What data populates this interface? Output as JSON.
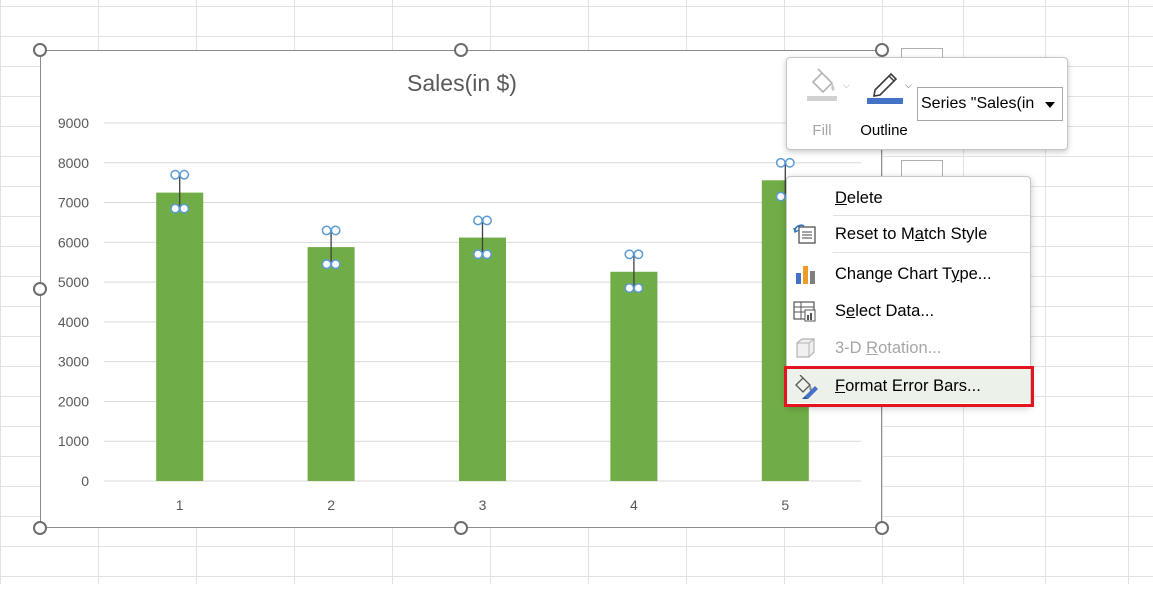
{
  "colors": {
    "bar_fill": "#70ad47",
    "gridline": "#d9d9d9",
    "error_handle": "#5b9bd5",
    "menu_highlight": "#ecf2ea",
    "annotation_border": "#e3131f",
    "outline_icon_bar": "#4472c4"
  },
  "chart_data": {
    "type": "bar",
    "title": "Sales(in $)",
    "categories": [
      "1",
      "2",
      "3",
      "4",
      "5"
    ],
    "series": [
      {
        "values": [
          7250,
          5880,
          6120,
          5260,
          7560
        ],
        "color": "#70ad47"
      }
    ],
    "error_bars": {
      "type": "standard deviation",
      "low": [
        6850,
        5450,
        5700,
        4850,
        7150
      ],
      "high": [
        7700,
        6300,
        6550,
        5700,
        8000
      ]
    },
    "ylim": [
      0,
      9000
    ],
    "yticks": [
      0,
      1000,
      2000,
      3000,
      4000,
      5000,
      6000,
      7000,
      8000,
      9000
    ],
    "xlabel": "",
    "ylabel": "",
    "grid": true,
    "legend": "none"
  },
  "mini_toolbar": {
    "fill_label": "Fill",
    "fill_icon": "paint-bucket-icon",
    "outline_label": "Outline",
    "outline_icon": "pen-outline-icon",
    "series_selector_value": "Series \"Sales(in"
  },
  "context_menu": {
    "items": [
      {
        "label": "Delete",
        "underline": "D",
        "icon": "none",
        "disabled": false
      },
      {
        "label": "Reset to Match Style",
        "underline": "a",
        "icon": "reset-style-icon",
        "disabled": false
      },
      {
        "label": "Change Chart Type...",
        "underline": "Y",
        "icon": "chart-type-icon",
        "disabled": false
      },
      {
        "label": "Select Data...",
        "underline": "e",
        "icon": "select-data-icon",
        "disabled": false
      },
      {
        "label": "3-D Rotation...",
        "underline": "R",
        "icon": "3d-rotation-icon",
        "disabled": true
      },
      {
        "label": "Format Error Bars...",
        "underline": "F",
        "icon": "format-error-bars-icon",
        "disabled": false,
        "highlighted": true
      }
    ]
  }
}
